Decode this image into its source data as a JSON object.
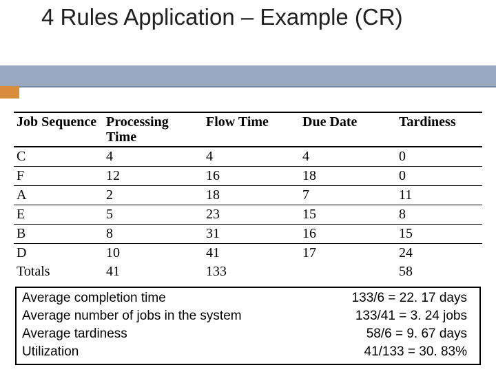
{
  "title": "4 Rules Application – Example (CR)",
  "headers": {
    "job": "Job Sequence",
    "proc": "Processing Time",
    "flow": "Flow Time",
    "due": "Due Date",
    "tard": "Tardiness"
  },
  "rows": [
    {
      "job": "C",
      "proc": "4",
      "flow": "4",
      "due": "4",
      "tard": "0"
    },
    {
      "job": "F",
      "proc": "12",
      "flow": "16",
      "due": "18",
      "tard": "0"
    },
    {
      "job": "A",
      "proc": "2",
      "flow": "18",
      "due": "7",
      "tard": "11"
    },
    {
      "job": "E",
      "proc": "5",
      "flow": "23",
      "due": "15",
      "tard": "8"
    },
    {
      "job": "B",
      "proc": "8",
      "flow": "31",
      "due": "16",
      "tard": "15"
    }
  ],
  "lastgroup": {
    "job1": "D",
    "proc1": "10",
    "flow1": "41",
    "due1": "17",
    "tard1": "24",
    "job2": "Totals",
    "proc2": "41",
    "flow2": "133",
    "due2": "",
    "tard2": "58"
  },
  "metrics": [
    {
      "label": "Average completion time",
      "value": "133/6 = 22. 17 days"
    },
    {
      "label": "Average number of jobs in the system",
      "value": "133/41 = 3. 24 jobs"
    },
    {
      "label": "Average tardiness",
      "value": "58/6 = 9. 67 days"
    },
    {
      "label": "Utilization",
      "value": "41/133 = 30. 83%"
    }
  ],
  "chart_data": {
    "type": "table",
    "title": "4 Rules Application – Example (CR)",
    "columns": [
      "Job Sequence",
      "Processing Time",
      "Flow Time",
      "Due Date",
      "Tardiness"
    ],
    "rows": [
      [
        "C",
        4,
        4,
        4,
        0
      ],
      [
        "F",
        12,
        16,
        18,
        0
      ],
      [
        "A",
        2,
        18,
        7,
        11
      ],
      [
        "E",
        5,
        23,
        15,
        8
      ],
      [
        "B",
        8,
        31,
        16,
        15
      ],
      [
        "D",
        10,
        41,
        17,
        24
      ]
    ],
    "totals": {
      "Processing Time": 41,
      "Flow Time": 133,
      "Tardiness": 58
    },
    "summary": {
      "Average completion time (days)": 22.17,
      "Average number of jobs in the system": 3.24,
      "Average tardiness (days)": 9.67,
      "Utilization (%)": 30.83
    }
  }
}
